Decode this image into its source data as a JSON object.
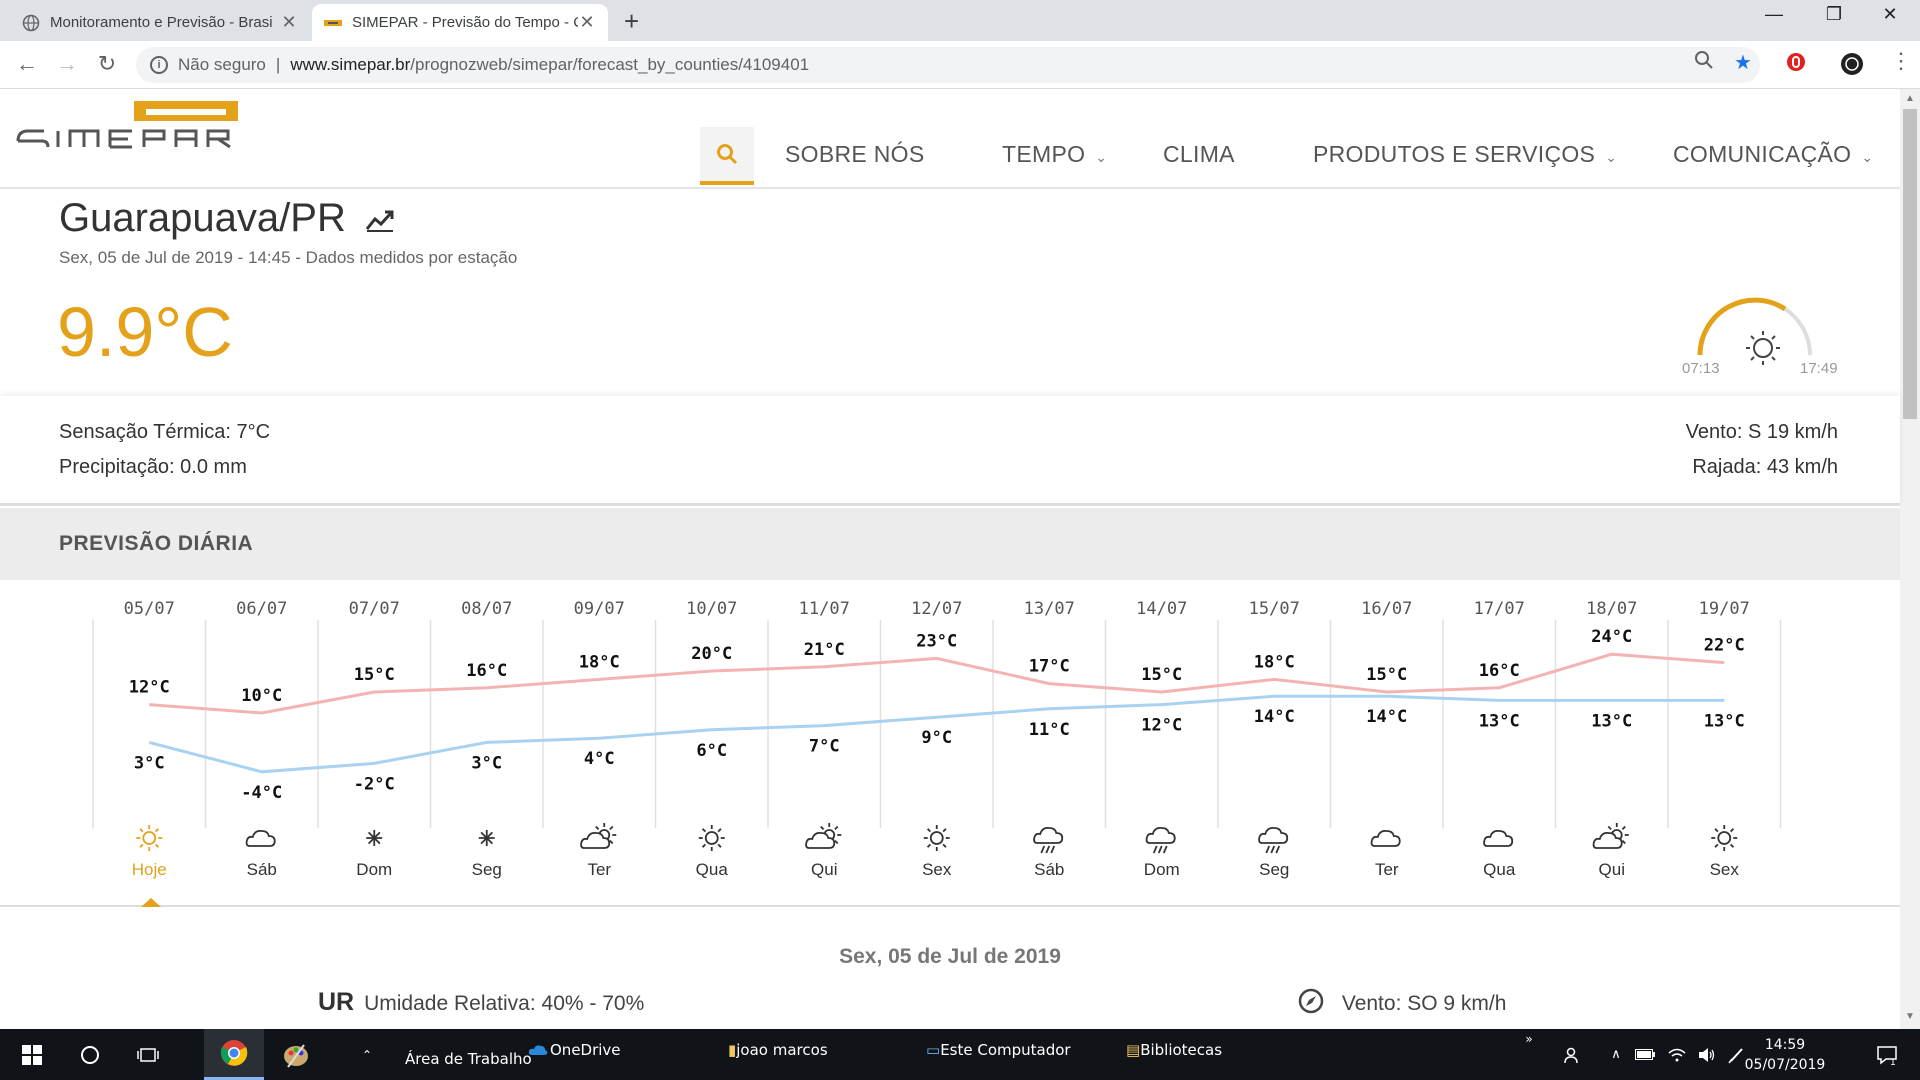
{
  "browser": {
    "tabs": [
      {
        "title": "Monitoramento e Previsão - Brasi"
      },
      {
        "title": "SIMEPAR - Previsão do Tempo - C"
      }
    ],
    "address": {
      "security": "Não seguro",
      "host": "www.simepar.br",
      "path": "/prognozweb/simepar/forecast_by_counties/4109401"
    }
  },
  "nav": {
    "items": [
      "SOBRE NÓS",
      "TEMPO",
      "CLIMA",
      "PRODUTOS E SERVIÇOS",
      "COMUNICAÇÃO"
    ]
  },
  "current": {
    "city": "Guarapuava/PR",
    "datetime": "Sex, 05 de Jul de 2019 - 14:45 - Dados medidos por estação",
    "temperature": "9.9°C",
    "sunrise": "07:13",
    "sunset": "17:49",
    "feels_like": "Sensação Térmica: 7°C",
    "precipitation": "Precipitação: 0.0 mm",
    "wind": "Vento: S 19 km/h",
    "gust": "Rajada: 43 km/h"
  },
  "daily": {
    "title": "PREVISÃO DIÁRIA",
    "selected_date": "Sex, 05 de Jul de 2019",
    "humidity_abbr": "UR",
    "humidity": "Umidade Relativa: 40% - 70%",
    "wind": "Vento: SO 9 km/h"
  },
  "chart_data": {
    "type": "line",
    "x": [
      "05/07",
      "06/07",
      "07/07",
      "08/07",
      "09/07",
      "10/07",
      "11/07",
      "12/07",
      "13/07",
      "14/07",
      "15/07",
      "16/07",
      "17/07",
      "18/07",
      "19/07"
    ],
    "day_labels": [
      "Hoje",
      "Sáb",
      "Dom",
      "Seg",
      "Ter",
      "Qua",
      "Qui",
      "Sex",
      "Sáb",
      "Dom",
      "Seg",
      "Ter",
      "Qua",
      "Qui",
      "Sex"
    ],
    "icons": [
      "sun-icon",
      "cloud-icon",
      "star-icon",
      "star-icon",
      "partly-cloudy-icon",
      "sun-icon",
      "partly-cloudy-icon",
      "sun-icon",
      "rain-icon",
      "rain-icon",
      "rain-icon",
      "cloud-icon",
      "cloud-icon",
      "partly-cloudy-icon",
      "sun-icon"
    ],
    "series": [
      {
        "values": [
          12,
          10,
          15,
          16,
          18,
          20,
          21,
          23,
          17,
          15,
          18,
          15,
          16,
          24,
          22
        ],
        "color": "#f4b3b3"
      },
      {
        "values": [
          3,
          -4,
          -2,
          3,
          4,
          6,
          7,
          9,
          11,
          12,
          14,
          14,
          13,
          13,
          13
        ],
        "color": "#a9d2f0"
      }
    ],
    "unit": "°C"
  },
  "taskbar": {
    "items": [
      "Área de Trabalho",
      "OneDrive",
      "joao marcos",
      "Este Computador",
      "Bibliotecas"
    ],
    "time": "14:59",
    "date": "05/07/2019"
  },
  "colors": {
    "accent": "#e3a21a"
  }
}
